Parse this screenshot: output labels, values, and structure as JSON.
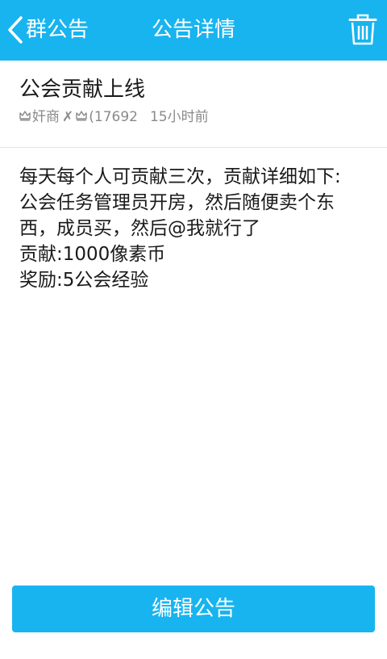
{
  "nav": {
    "back_label": "群公告",
    "title": "公告详情"
  },
  "announcement": {
    "title": "公会贡献上线",
    "author_part1": "奸商",
    "author_part2": "(17692",
    "time": "15小时前",
    "body_lines": [
      "每天每个人可贡献三次，贡献详细如下:",
      "公会任务管理员开房，然后随便卖个东",
      "西，成员买，然后@我就行了",
      "贡献:1000像素币",
      "奖励:5公会经验"
    ]
  },
  "footer": {
    "edit_label": "编辑公告"
  },
  "icons": {
    "back": "chevron-left-icon",
    "delete": "trash-icon",
    "author_badge": "crown-icon",
    "author_separator": "x-mark-icon"
  },
  "colors": {
    "primary": "#18b4ef",
    "text": "#1a1a1a",
    "meta_text": "#8a8a8a",
    "divider": "#e3e3e3"
  }
}
